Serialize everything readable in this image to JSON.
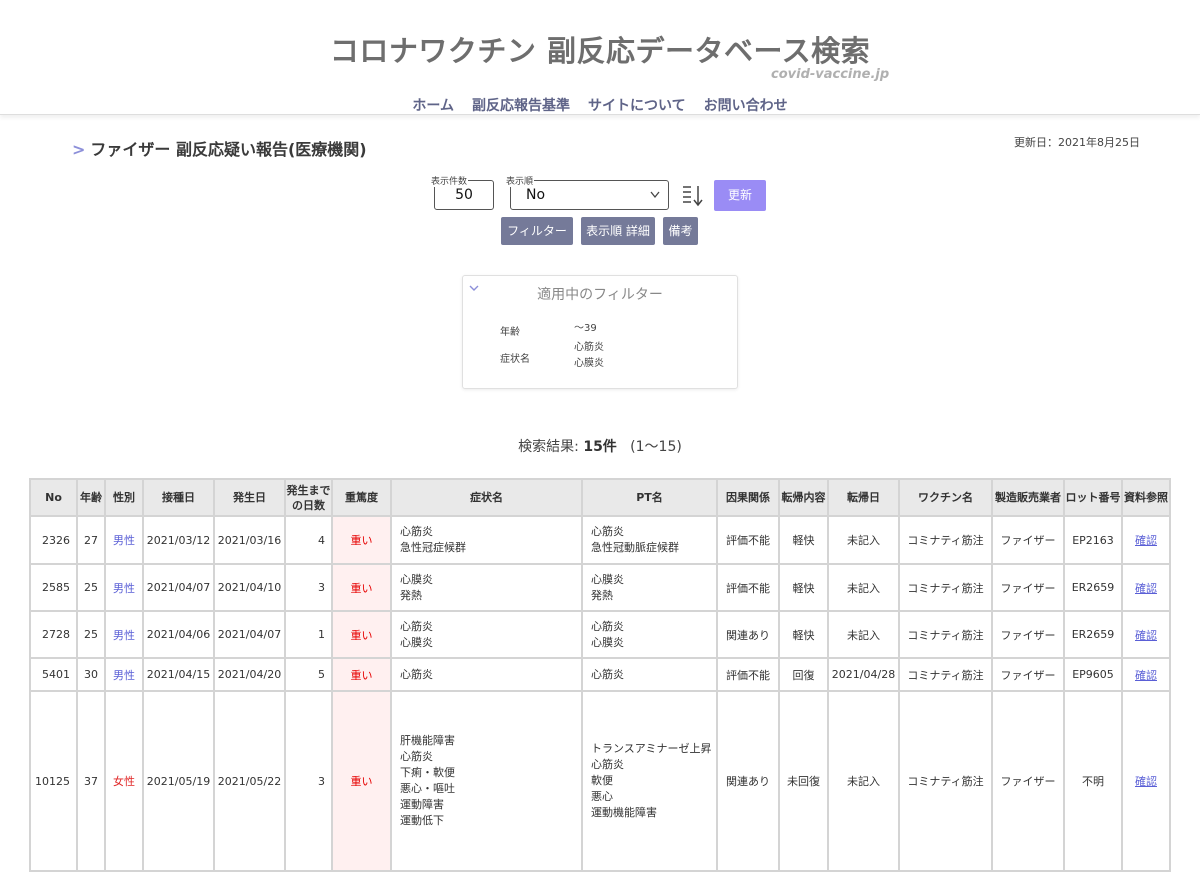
{
  "site": {
    "title": "コロナワクチン 副反応データベース検索",
    "domain": "covid-vaccine.jp"
  },
  "nav": {
    "items": [
      "ホーム",
      "副反応報告基準",
      "サイトについて",
      "お問い合わせ"
    ]
  },
  "page": {
    "breadcrumb_marker": ">",
    "title": "ファイザー 副反応疑い報告(医療機関)",
    "updated": "更新日：2021年8月25日"
  },
  "controls": {
    "count_label": "表示件数",
    "count_value": "50",
    "order_label": "表示順",
    "order_value": "No",
    "update_label": "更新",
    "filter_label": "フィルター",
    "order_detail_label": "表示順 詳細",
    "notes_label": "備考"
  },
  "filters": {
    "title": "適用中のフィルター",
    "age_key": "年齢",
    "age_value": "～39",
    "symptom_key": "症状名",
    "symptom_values": [
      "心筋炎",
      "心膜炎"
    ]
  },
  "result": {
    "label": "検索結果:",
    "count": "15件",
    "range": "(1〜15)"
  },
  "table": {
    "headers": [
      "No",
      "年齢",
      "性別",
      "接種日",
      "発生日",
      "発生までの日数",
      "重篤度",
      "症状名",
      "PT名",
      "因果関係",
      "転帰内容",
      "転帰日",
      "ワクチン名",
      "製造販売業者",
      "ロット番号",
      "資料参照"
    ],
    "rows": [
      {
        "no": "2326",
        "age": "27",
        "sex": "男性",
        "sex_type": "male",
        "vac_date": "2021/03/12",
        "onset": "2021/03/16",
        "days": "4",
        "severity": "重い",
        "symptoms": [
          "心筋炎",
          "急性冠症候群"
        ],
        "pt": [
          "心筋炎",
          "急性冠動脈症候群"
        ],
        "causality": "評価不能",
        "outcome": "軽快",
        "outcome_date": "未記入",
        "vaccine": "コミナティ筋注",
        "maker": "ファイザー",
        "lot": "EP2163",
        "ref": "確認"
      },
      {
        "no": "2585",
        "age": "25",
        "sex": "男性",
        "sex_type": "male",
        "vac_date": "2021/04/07",
        "onset": "2021/04/10",
        "days": "3",
        "severity": "重い",
        "symptoms": [
          "心膜炎",
          "発熱"
        ],
        "pt": [
          "心膜炎",
          "発熱"
        ],
        "causality": "評価不能",
        "outcome": "軽快",
        "outcome_date": "未記入",
        "vaccine": "コミナティ筋注",
        "maker": "ファイザー",
        "lot": "ER2659",
        "ref": "確認"
      },
      {
        "no": "2728",
        "age": "25",
        "sex": "男性",
        "sex_type": "male",
        "vac_date": "2021/04/06",
        "onset": "2021/04/07",
        "days": "1",
        "severity": "重い",
        "symptoms": [
          "心筋炎",
          "心膜炎"
        ],
        "pt": [
          "心筋炎",
          "心膜炎"
        ],
        "causality": "関連あり",
        "outcome": "軽快",
        "outcome_date": "未記入",
        "vaccine": "コミナティ筋注",
        "maker": "ファイザー",
        "lot": "ER2659",
        "ref": "確認"
      },
      {
        "no": "5401",
        "age": "30",
        "sex": "男性",
        "sex_type": "male",
        "vac_date": "2021/04/15",
        "onset": "2021/04/20",
        "days": "5",
        "severity": "重い",
        "symptoms": [
          "心筋炎"
        ],
        "pt": [
          "心筋炎"
        ],
        "causality": "評価不能",
        "outcome": "回復",
        "outcome_date": "2021/04/28",
        "vaccine": "コミナティ筋注",
        "maker": "ファイザー",
        "lot": "EP9605",
        "ref": "確認"
      },
      {
        "no": "10125",
        "age": "37",
        "sex": "女性",
        "sex_type": "female",
        "vac_date": "2021/05/19",
        "onset": "2021/05/22",
        "days": "3",
        "severity": "重い",
        "symptoms": [
          "肝機能障害",
          "心筋炎",
          "下痢・軟便",
          "悪心・嘔吐",
          "運動障害",
          "運動低下"
        ],
        "pt": [
          "トランスアミナーゼ上昇",
          "心筋炎",
          "軟便",
          "悪心",
          "運動機能障害"
        ],
        "causality": "関連あり",
        "outcome": "未回復",
        "outcome_date": "未記入",
        "vaccine": "コミナティ筋注",
        "maker": "ファイザー",
        "lot": "不明",
        "ref": "確認"
      }
    ]
  },
  "colors": {
    "accent": "#9a8cf5",
    "button": "#757a99",
    "male": "#5a5fd6",
    "female": "#e02626",
    "severe": "#e60000"
  }
}
